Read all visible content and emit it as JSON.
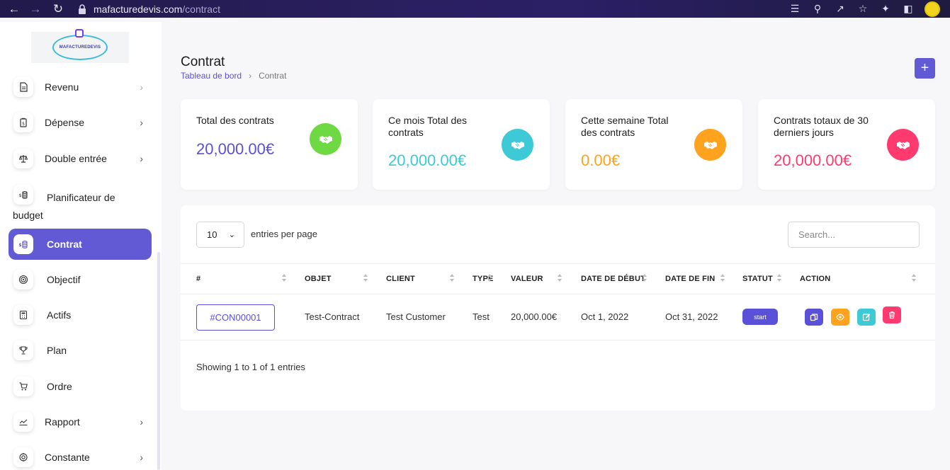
{
  "browser": {
    "url_domain": "mafacturedevis.com",
    "url_path": "/contract"
  },
  "sidebar": {
    "logo_text": "MAFACTUREDEVIS",
    "items": [
      {
        "label": "Revenu",
        "icon": "file-icon",
        "chevron": true
      },
      {
        "label": "Dépense",
        "icon": "receipt-icon",
        "chevron": true
      },
      {
        "label": "Double entrée",
        "icon": "scale-icon",
        "chevron": true
      },
      {
        "label": "Planificateur de budget",
        "icon": "coins-icon",
        "chevron": false
      },
      {
        "label": "Contrat",
        "icon": "coins-icon",
        "chevron": false,
        "active": true
      },
      {
        "label": "Objectif",
        "icon": "target-icon",
        "chevron": false
      },
      {
        "label": "Actifs",
        "icon": "calculator-icon",
        "chevron": false
      },
      {
        "label": "Plan",
        "icon": "trophy-icon",
        "chevron": false
      },
      {
        "label": "Ordre",
        "icon": "cart-icon",
        "chevron": false
      },
      {
        "label": "Rapport",
        "icon": "chart-line-icon",
        "chevron": true
      },
      {
        "label": "Constante",
        "icon": "settings-icon",
        "chevron": true
      }
    ]
  },
  "header": {
    "title": "Contrat",
    "breadcrumb": [
      "Tableau de bord",
      "Contrat"
    ],
    "add_label": "+"
  },
  "stats": [
    {
      "label": "Total des contrats",
      "value": "20,000.00€",
      "color": "#5b51d8",
      "icon_bg": "#6fd943",
      "icon": "handshake-icon"
    },
    {
      "label": "Ce mois Total des contrats",
      "value": "20,000.00€",
      "color": "#3ec9d6",
      "icon_bg": "#3ec9d6",
      "icon": "handshake-icon"
    },
    {
      "label": "Cette semaine Total des contrats",
      "value": "0.00€",
      "color": "#ffa21d",
      "icon_bg": "#ffa21d",
      "icon": "handshake-icon"
    },
    {
      "label": "Contrats totaux de 30 derniers jours",
      "value": "20,000.00€",
      "color": "#ff3a6e",
      "icon_bg": "#ff3a6e",
      "icon": "handshake-icon"
    }
  ],
  "table": {
    "per_page": "10",
    "per_page_label": "entries per page",
    "search_placeholder": "Search...",
    "columns": [
      "#",
      "OBJET",
      "CLIENT",
      "TYPE",
      "VALEUR",
      "DATE DE DÉBUT",
      "DATE DE FIN",
      "STATUT",
      "ACTION"
    ],
    "rows": [
      {
        "id": "#CON00001",
        "objet": "Test-Contract",
        "client": "Test Customer",
        "type": "Test",
        "valeur": "20,000.00€",
        "debut": "Oct 1, 2022",
        "fin": "Oct 31, 2022",
        "statut": "start"
      }
    ],
    "actions": [
      {
        "icon": "copy-icon",
        "color": "#5b51d8"
      },
      {
        "icon": "eye-icon",
        "color": "#ffa21d"
      },
      {
        "icon": "edit-icon",
        "color": "#3ec9d6"
      },
      {
        "icon": "trash-icon",
        "color": "#ff3a6e"
      }
    ],
    "showing": "Showing 1 to 1 of 1 entries"
  }
}
